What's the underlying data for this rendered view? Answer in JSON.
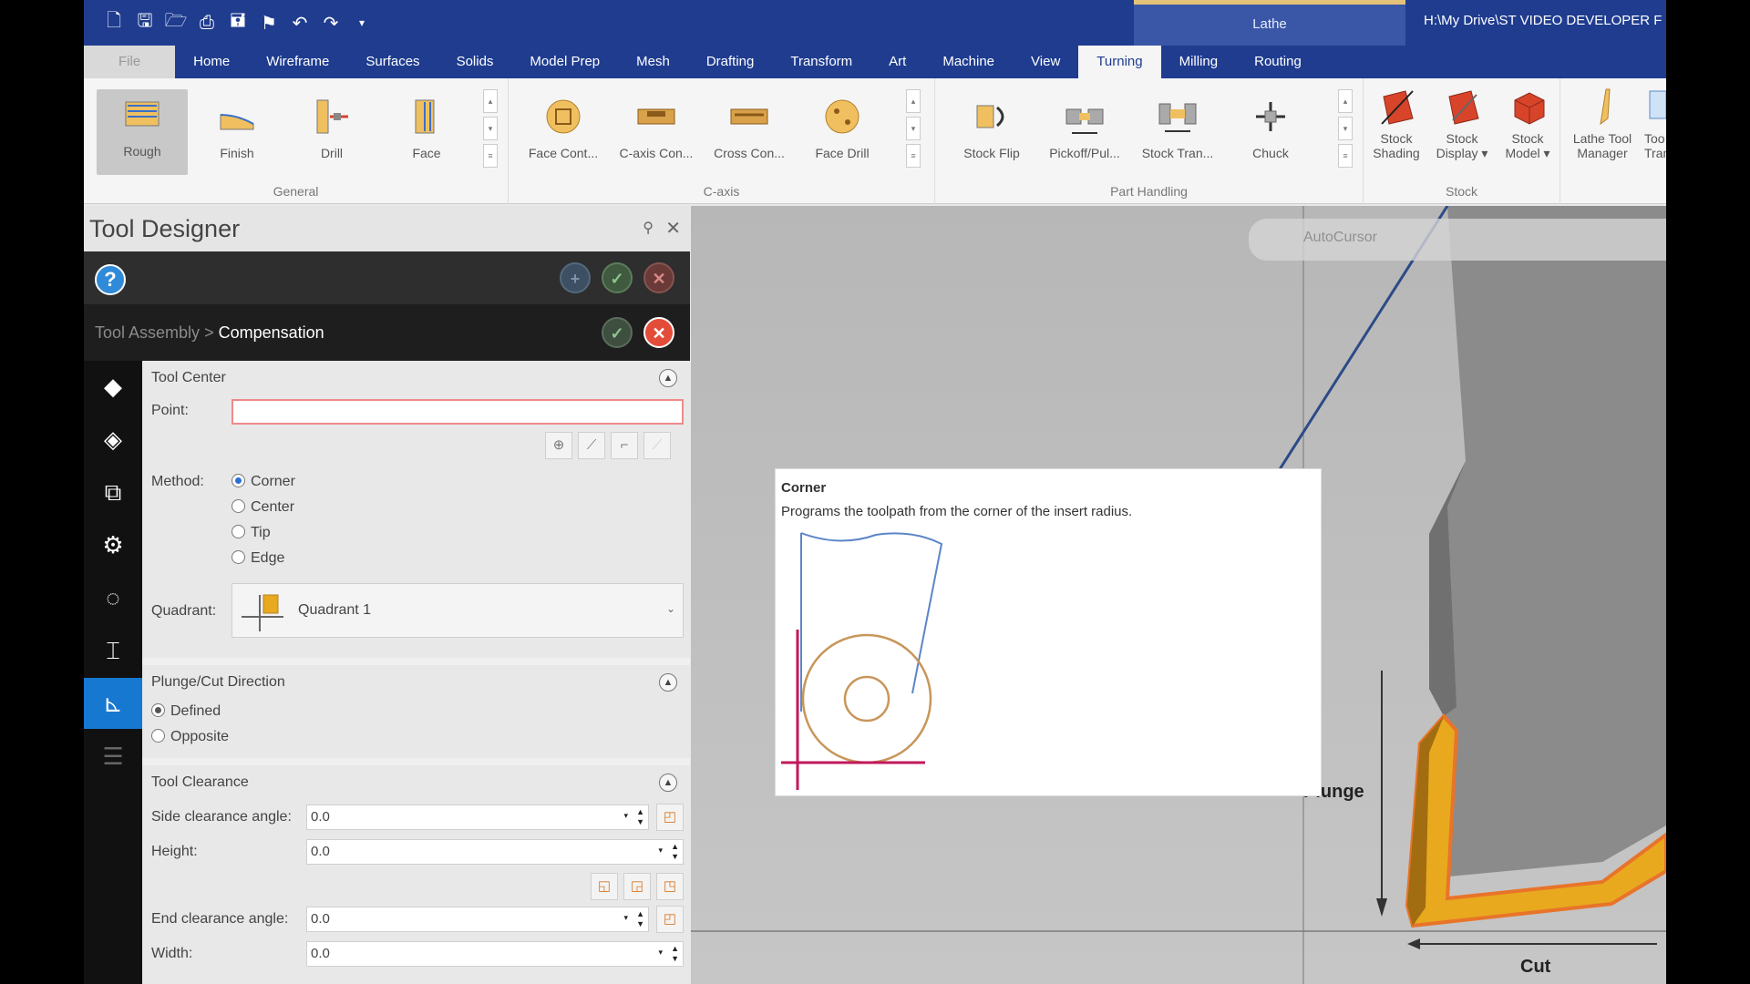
{
  "title_bar": {
    "context_tab": "Lathe",
    "path": "H:\\My Drive\\ST VIDEO DEVELOPER F"
  },
  "tabs": [
    "File",
    "Home",
    "Wireframe",
    "Surfaces",
    "Solids",
    "Model Prep",
    "Mesh",
    "Drafting",
    "Transform",
    "Art",
    "Machine",
    "View",
    "Turning",
    "Milling",
    "Routing"
  ],
  "active_tab": "Turning",
  "ribbon": {
    "general": {
      "label": "General",
      "buttons": [
        "Rough",
        "Finish",
        "Drill",
        "Face"
      ]
    },
    "caxis": {
      "label": "C-axis",
      "buttons": [
        "Face Cont...",
        "C-axis Con...",
        "Cross Con...",
        "Face Drill"
      ]
    },
    "part_handling": {
      "label": "Part Handling",
      "buttons": [
        "Stock Flip",
        "Pickoff/Pul...",
        "Stock Tran...",
        "Chuck"
      ]
    },
    "stock": {
      "label": "Stock",
      "buttons": [
        {
          "line1": "Stock",
          "line2": "Shading"
        },
        {
          "line1": "Stock",
          "line2": "Display ▾"
        },
        {
          "line1": "Stock",
          "line2": "Model ▾"
        }
      ]
    },
    "more": [
      {
        "line1": "Lathe Tool",
        "line2": "Manager"
      },
      {
        "line1": "Too",
        "line2": "Tran"
      }
    ]
  },
  "panel": {
    "title": "Tool Designer",
    "breadcrumb_parent": "Tool Assembly",
    "breadcrumb_sep": " > ",
    "breadcrumb_current": "Compensation",
    "tool_center": {
      "heading": "Tool Center",
      "point_label": "Point:",
      "point_value": "",
      "method_label": "Method:",
      "methods": [
        "Corner",
        "Center",
        "Tip",
        "Edge"
      ],
      "method_selected": "Corner",
      "quadrant_label": "Quadrant:",
      "quadrant_value": "Quadrant 1"
    },
    "plunge_cut": {
      "heading": "Plunge/Cut Direction",
      "options": [
        "Defined",
        "Opposite"
      ],
      "selected": "Defined"
    },
    "clearance": {
      "heading": "Tool Clearance",
      "side_label": "Side clearance angle:",
      "side_value": "0.0",
      "height_label": "Height:",
      "height_value": "0.0",
      "end_label": "End clearance angle:",
      "end_value": "0.0",
      "width_label": "Width:",
      "width_value": "0.0"
    }
  },
  "tooltip": {
    "title": "Corner",
    "description": "Programs the toolpath from the corner of the insert radius."
  },
  "viewport": {
    "autocursor": "AutoCursor",
    "plunge_label": "Plunge",
    "cut_label": "Cut"
  },
  "colors": {
    "title_bar": "#1f3c8f",
    "accent": "#1778d1",
    "error_border": "#f08a8a",
    "insert_fill": "#e8a91f"
  }
}
